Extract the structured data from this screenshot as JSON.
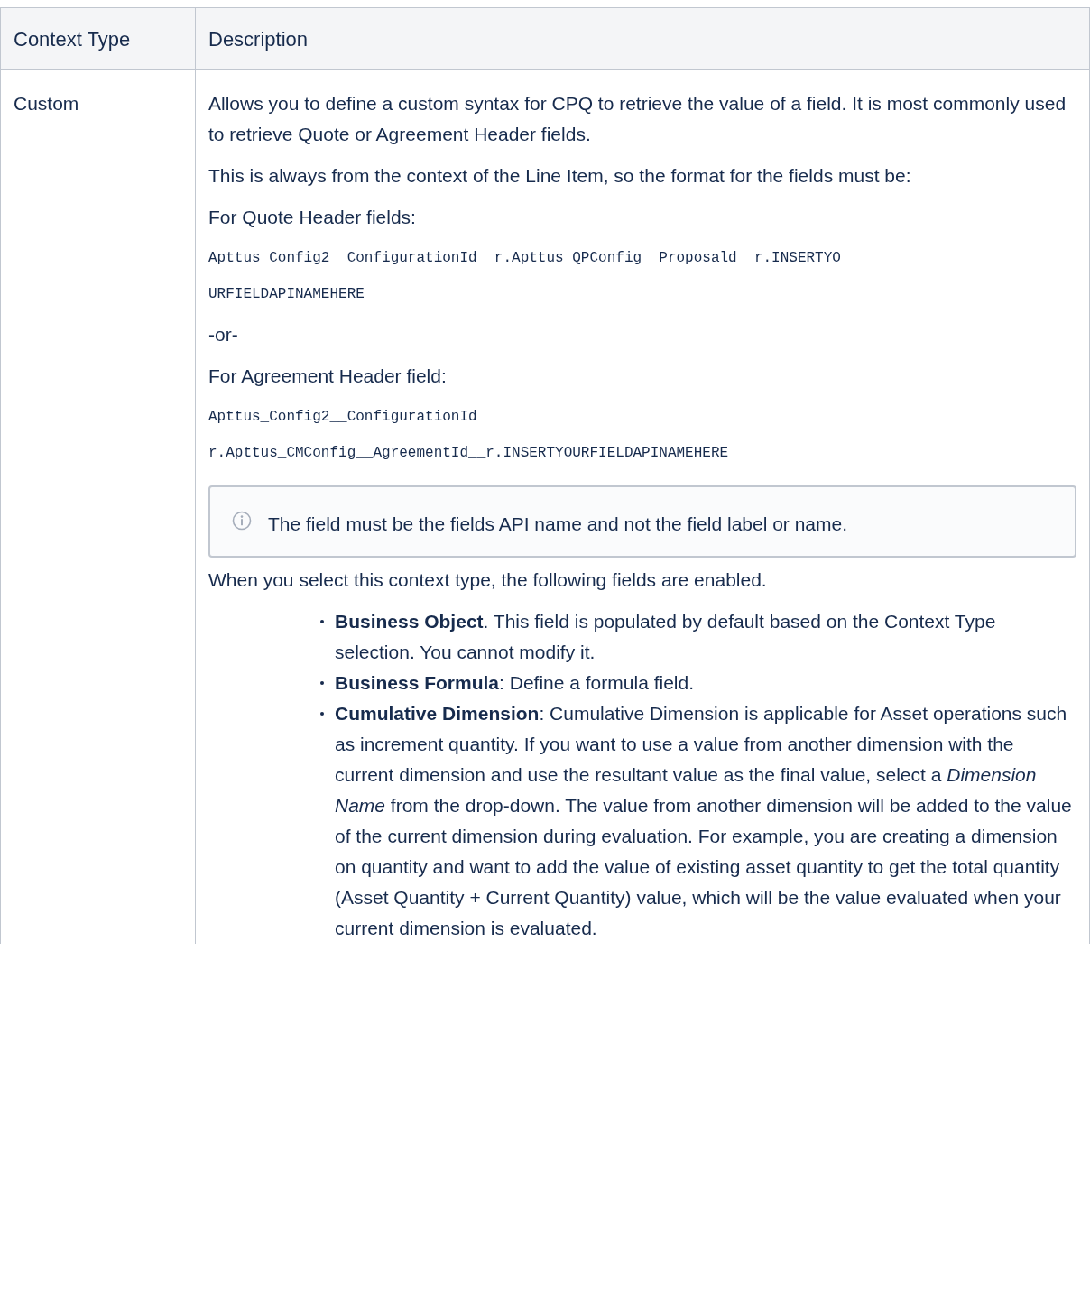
{
  "table": {
    "columns": [
      "Context Type",
      "Description"
    ],
    "rows": [
      {
        "context_type": "Custom",
        "description": [
          {
            "kind": "text",
            "text": "Allows you to define a custom syntax for CPQ to retrieve the value of a field. It is most commonly used to retrieve Quote or Agreement Header fields."
          },
          {
            "kind": "text_tight",
            "text": "This is always from the context of the Line Item, so the format for the fields must be:"
          },
          {
            "kind": "text",
            "text": "For Quote Header fields:"
          },
          {
            "kind": "code",
            "lines": [
              "Apttus_Config2__ConfigurationId__r.Apttus_QPConfig__Proposald__r.INSERTYO",
              "URFIELDAPINAMEHERE"
            ]
          },
          {
            "kind": "text",
            "text": "-or-"
          },
          {
            "kind": "text",
            "text": "For Agreement Header field:"
          },
          {
            "kind": "code",
            "lines": [
              "Apttus_Config2__ConfigurationId",
              "r.Apttus_CMConfig__AgreementId__r.INSERTYOURFIELDAPINAMEHERE"
            ]
          },
          {
            "kind": "note",
            "text": "The field must be the fields API name and not the field label or name."
          },
          {
            "kind": "text",
            "text": "When you select this context type, the following fields are enabled."
          },
          {
            "kind": "list",
            "items": [
              "**Business Object**. This field is populated by default based on the Context Type selection. You cannot modify it.",
              "**Business Formula**: Define a formula field.",
              "**Cumulative Dimension**: Cumulative Dimension is applicable for Asset operations such as increment quantity. If you want to use a value from another dimension with the current dimension and use the resultant value as the final value, select a *Dimension Name* from the drop-down. The value from another dimension will be added to the value of the current dimension during evaluation. For example, you are creating a dimension on quantity and want to add the value of existing asset quantity to get the total quantity (Asset Quantity + Current Quantity) value, which will be the value evaluated when your current dimension is evaluated."
            ]
          }
        ]
      }
    ]
  }
}
